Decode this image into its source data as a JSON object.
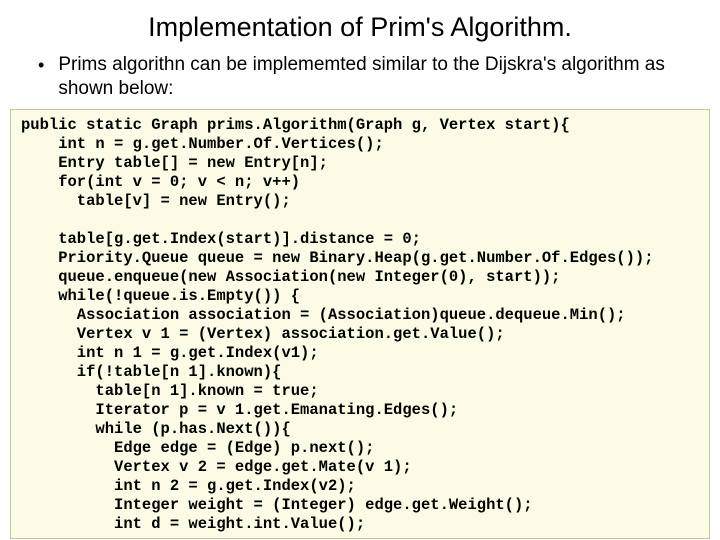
{
  "title": "Implementation of Prim's Algorithm.",
  "bullet": "Prims algorithn can be implememted similar to the Dijskra's algorithm as shown below:",
  "code": "public static Graph prims.Algorithm(Graph g, Vertex start){\n    int n = g.get.Number.Of.Vertices();\n    Entry table[] = new Entry[n];\n    for(int v = 0; v < n; v++)\n      table[v] = new Entry();\n\n    table[g.get.Index(start)].distance = 0;\n    Priority.Queue queue = new Binary.Heap(g.get.Number.Of.Edges());\n    queue.enqueue(new Association(new Integer(0), start));\n    while(!queue.is.Empty()) {\n      Association association = (Association)queue.dequeue.Min();\n      Vertex v 1 = (Vertex) association.get.Value();\n      int n 1 = g.get.Index(v1);\n      if(!table[n 1].known){\n        table[n 1].known = true;\n        Iterator p = v 1.get.Emanating.Edges();\n        while (p.has.Next()){\n          Edge edge = (Edge) p.next();\n          Vertex v 2 = edge.get.Mate(v 1);\n          int n 2 = g.get.Index(v2);\n          Integer weight = (Integer) edge.get.Weight();\n          int d = weight.int.Value();"
}
